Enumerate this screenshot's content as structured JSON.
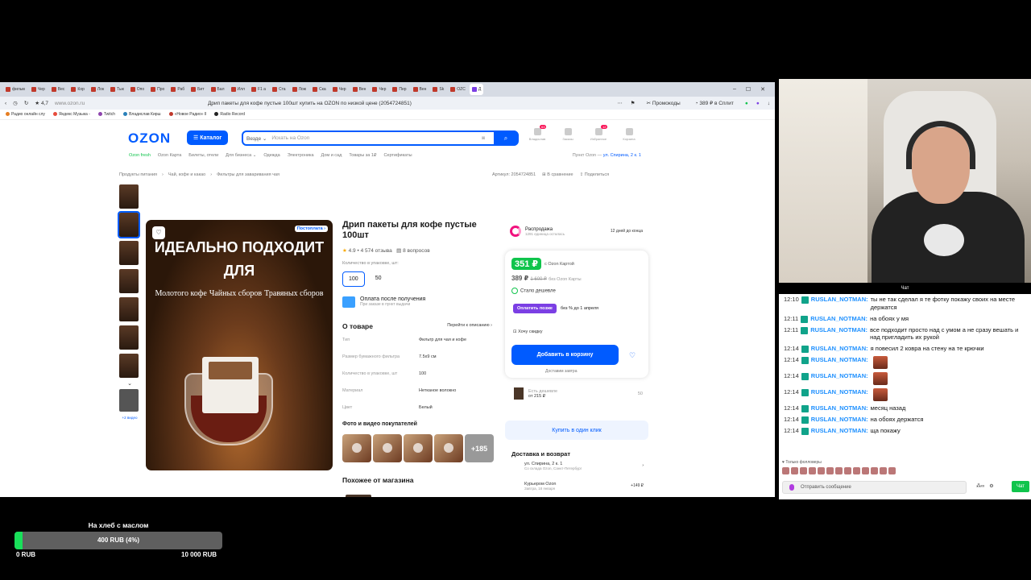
{
  "browser": {
    "tabs": [
      "фильм",
      "Чер",
      "Вес",
      "Кор",
      "Лок",
      "Тык",
      "Опо",
      "Про",
      "Раб",
      "Бит",
      "Бал",
      "Илл",
      "F1 а",
      "Ста",
      "Лож",
      "Ска",
      "Чер",
      "Вен",
      "Чер",
      "Пер",
      "Вен",
      "Sk",
      "OZC",
      "Д"
    ],
    "rating": "4,7",
    "url": "www.ozon.ru",
    "page_title": "Дрип пакеты для кофе пустые 100шт купить на OZON по низкой цене (2054724851)",
    "promocodes": "Промокоды",
    "split": "389 ₽ в Сплит",
    "bookmarks": [
      "Радио онлайн слу",
      "Яндекс Музыка -",
      "Twitch",
      "Владислав Кирш",
      "«Новое Радио» Il",
      "Radio Record"
    ]
  },
  "ozon": {
    "logo": "OZON",
    "catalog": "Каталог",
    "search_scope": "Везде ⌄",
    "search_placeholder": "Искать на Ozon",
    "header_icons": [
      {
        "label": "Владислав",
        "badge": "63"
      },
      {
        "label": "Заказы",
        "badge": ""
      },
      {
        "label": "Избранное",
        "badge": "12"
      },
      {
        "label": "Корзина",
        "badge": ""
      }
    ],
    "subnav": [
      "Ozon fresh",
      "Ozon Карта",
      "Билеты, отели",
      "Для бизнеса ⌄",
      "Одежда",
      "Электроника",
      "Дом и сад",
      "Товары за 1₽",
      "Сертификаты"
    ],
    "pickup_label": "Пункт Ozon",
    "pickup_addr": "ул. Спирина, 2 к. 1",
    "crumbs": [
      "Продукты питания",
      "Чай, кофе и какао",
      "Фильтры для заваривания чая"
    ],
    "article": "Артикул: 2054724851",
    "compare": "В сравнение",
    "share": "Поделиться",
    "thumbs_more": "+2 видео",
    "image": {
      "postpay": "Постоплата ›",
      "headline": "ИДЕАЛЬНО ПОДХОДИТ ДЛЯ",
      "col1": "Молотого кофе",
      "col2": "Чайных сборов",
      "col3": "Травяных сборов"
    },
    "product_title": "Дрип пакеты для кофе пустые 100шт",
    "rating_text": "4.9 • 4 574 отзыва",
    "questions": "8 вопросов",
    "qty_label": "Количество в упаковке, шт:",
    "qty_options": [
      "100",
      "50"
    ],
    "payafter_title": "Оплата после получения",
    "payafter_sub": "При заказе в пункт выдачи",
    "about_title": "О товаре",
    "about_link": "Перейти к описанию ›",
    "specs": [
      {
        "k": "Тип",
        "v": "Фильтр для чая и кофе"
      },
      {
        "k": "Размер бумажного фильтра",
        "v": "7.5x9 см"
      },
      {
        "k": "Количество в упаковке, шт",
        "v": "100"
      },
      {
        "k": "Материал",
        "v": "Нетканое волокно"
      },
      {
        "k": "Цвет",
        "v": "Белый"
      }
    ],
    "photos_title": "Фото и видео покупателей",
    "photos_more": "+185",
    "similar_title": "Похожее от магазина",
    "sale_title": "Распродажа",
    "sale_sub": "1291 единица осталась",
    "sale_days": "12 дней до конца",
    "price_card": "351 ₽",
    "price_card_label": "c Ozon Картой",
    "price_regular": "389 ₽",
    "price_old": "1 600 ₽",
    "price_regular_label": "без Ozon Карты",
    "cheaper_now": "Стало дешевле",
    "pay_later_btn": "Оплатить позже",
    "pay_later_text": "без % до 1 апреля",
    "want_discount": "Хочу скидку",
    "add_to_cart": "Добавить в корзину",
    "deliver_tomorrow": "Доставим завтра",
    "cheaper_offer_label": "Есть дешевле",
    "cheaper_offer_price": "от 215 ₽",
    "cheaper_offer_qty": "50",
    "one_click": "Купить в один клик",
    "delivery_title": "Доставка и возврат",
    "delivery": [
      {
        "t": "ул. Спирина, 2 к. 1",
        "s": "Со склада Ozon, Санкт-Петербург",
        "r": "›"
      },
      {
        "t": "Курьером Ozon",
        "s": "Завтра, 18 января",
        "r": "+149 ₽"
      },
      {
        "t": "Пункты выдачи и постаматы",
        "s": "Завтра, 18 января",
        "r": "Без доплат"
      },
      {
        "t": "Можно вернуть в течение 15 дней",
        "s": "",
        "r": ""
      }
    ]
  },
  "chat": {
    "header": "Чат",
    "messages": [
      {
        "t": "12:10",
        "u": "RUSLAN_NOTMAN",
        "m": "ты не так сделал я те фотку покажу своих на месте держатся"
      },
      {
        "t": "12:11",
        "u": "RUSLAN_NOTMAN",
        "m": "на обоях у мя"
      },
      {
        "t": "12:11",
        "u": "RUSLAN_NOTMAN",
        "m": "все подходит просто над с умом а не сразу вешать и над пригладить их рукой"
      },
      {
        "t": "12:14",
        "u": "RUSLAN_NOTMAN",
        "m": "я повесил 2 ковра на стену на те крючки"
      },
      {
        "t": "12:14",
        "u": "RUSLAN_NOTMAN",
        "m": ""
      },
      {
        "t": "12:14",
        "u": "RUSLAN_NOTMAN",
        "m": ""
      },
      {
        "t": "12:14",
        "u": "RUSLAN_NOTMAN",
        "m": ""
      },
      {
        "t": "12:14",
        "u": "RUSLAN_NOTMAN",
        "m": "месяц назад"
      },
      {
        "t": "12:14",
        "u": "RUSLAN_NOTMAN",
        "m": "на обоях держатся"
      },
      {
        "t": "12:14",
        "u": "RUSLAN_NOTMAN",
        "m": "ща покажу"
      }
    ],
    "followers_only": "Только фолловеры",
    "input_placeholder": "Отправить сообщение",
    "send": "Чат"
  },
  "donation": {
    "title": "На хлеб с маслом",
    "progress_label": "400 RUB (4%)",
    "progress": 0.04,
    "min": "0 RUB",
    "max": "10 000 RUB"
  }
}
